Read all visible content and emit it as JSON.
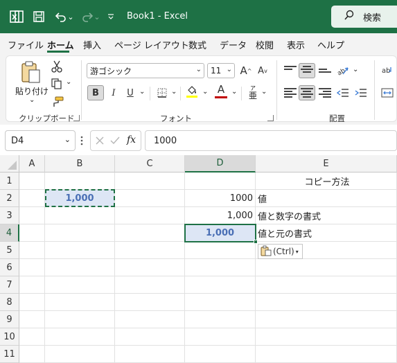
{
  "titlebar": {
    "title": "Book1  -  Excel",
    "search_label": "検索",
    "quick_access_chevron": "⌄"
  },
  "tabs": [
    {
      "label": "ファイル"
    },
    {
      "label": "ホーム",
      "active": true
    },
    {
      "label": "挿入"
    },
    {
      "label": "ページ レイアウト"
    },
    {
      "label": "数式"
    },
    {
      "label": "データ"
    },
    {
      "label": "校閲"
    },
    {
      "label": "表示"
    },
    {
      "label": "ヘルプ"
    }
  ],
  "ribbon": {
    "clipboard": {
      "paste_label": "貼り付け",
      "group_label": "クリップボード"
    },
    "font": {
      "font_name": "游ゴシック",
      "font_size": "11",
      "bold": "B",
      "italic": "I",
      "underline": "U",
      "increase_size": "A",
      "decrease_size": "A",
      "font_color_letter": "A",
      "phonetic_top": "ア",
      "phonetic_bottom": "亜",
      "group_label": "フォント"
    },
    "alignment": {
      "group_label": "配置"
    },
    "colors": {
      "font_color_bar": "#c00000",
      "fill_color_bar": "#ffff00"
    }
  },
  "formula_bar": {
    "name_box": "D4",
    "fx": "fx",
    "formula": "1000"
  },
  "grid": {
    "columns": [
      "A",
      "B",
      "C",
      "D",
      "E"
    ],
    "selected_column": "D",
    "rows": [
      "1",
      "2",
      "3",
      "4",
      "5",
      "6",
      "7",
      "8",
      "9",
      "10",
      "11"
    ],
    "selected_row": "4",
    "cells": {
      "E1": "コピー方法",
      "B2": "1,000",
      "D2": "1000",
      "E2": "値",
      "D3": "1,000",
      "E3": "値と数字の書式",
      "D4": "1,000",
      "E4": "値と元の書式"
    },
    "paste_options_label": "(Ctrl)"
  },
  "colors": {
    "accent": "#1e7145",
    "highlight_fill": "#dde6f5",
    "highlight_text": "#4a6fb5"
  }
}
